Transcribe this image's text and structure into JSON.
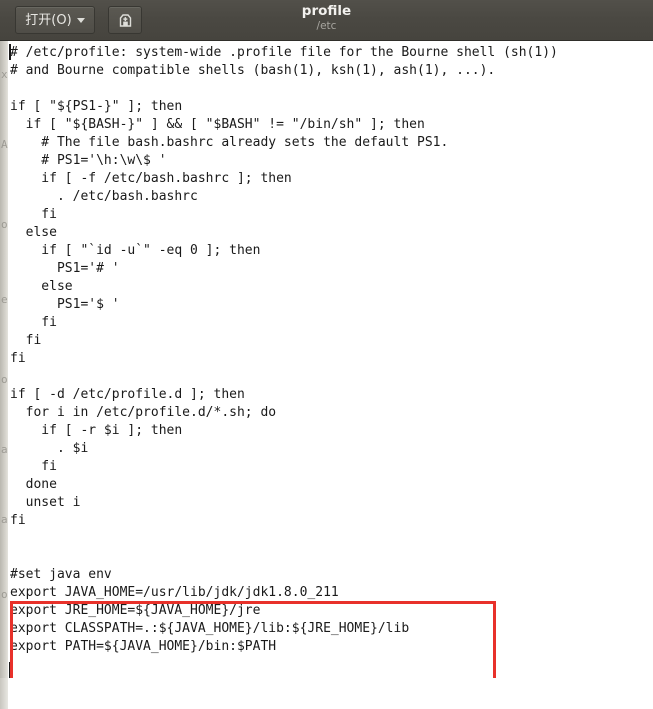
{
  "window": {
    "title": "profile",
    "subtitle": "/etc"
  },
  "toolbar": {
    "open_label": "打开(O)",
    "open_caret_icon": "chevron-down-icon",
    "save_icon": "save-floppy-icon"
  },
  "editor": {
    "file_name": "profile",
    "file_path": "/etc",
    "lines": [
      "# /etc/profile: system-wide .profile file for the Bourne shell (sh(1))",
      "# and Bourne compatible shells (bash(1), ksh(1), ash(1), ...).",
      "",
      "if [ \"${PS1-}\" ]; then",
      "  if [ \"${BASH-}\" ] && [ \"$BASH\" != \"/bin/sh\" ]; then",
      "    # The file bash.bashrc already sets the default PS1.",
      "    # PS1='\\h:\\w\\$ '",
      "    if [ -f /etc/bash.bashrc ]; then",
      "      . /etc/bash.bashrc",
      "    fi",
      "  else",
      "    if [ \"`id -u`\" -eq 0 ]; then",
      "      PS1='# '",
      "    else",
      "      PS1='$ '",
      "    fi",
      "  fi",
      "fi",
      "",
      "if [ -d /etc/profile.d ]; then",
      "  for i in /etc/profile.d/*.sh; do",
      "    if [ -r $i ]; then",
      "      . $i",
      "    fi",
      "  done",
      "  unset i",
      "fi",
      "",
      "",
      "#set java env",
      "export JAVA_HOME=/usr/lib/jdk/jdk1.8.0_211",
      "export JRE_HOME=${JAVA_HOME}/jre",
      "export CLASSPATH=.:${JAVA_HOME}/lib:${JRE_HOME}/lib",
      "export PATH=${JAVA_HOME}/bin:$PATH",
      ""
    ]
  },
  "annotation": {
    "color": "#e8312a",
    "target_note": "#set java env block"
  },
  "background_ghost_lines": [
    "x(",
    "AH",
    "o|",
    "e",
    "o",
    "a",
    "a",
    "o"
  ],
  "colors": {
    "headerbar": "#4a4842",
    "headerbar_text": "#f2f1ee",
    "headerbar_subtext": "#a8a6a0",
    "editor_background": "#ffffff",
    "editor_text": "#1a1a1a",
    "annotation_red": "#e8312a"
  }
}
